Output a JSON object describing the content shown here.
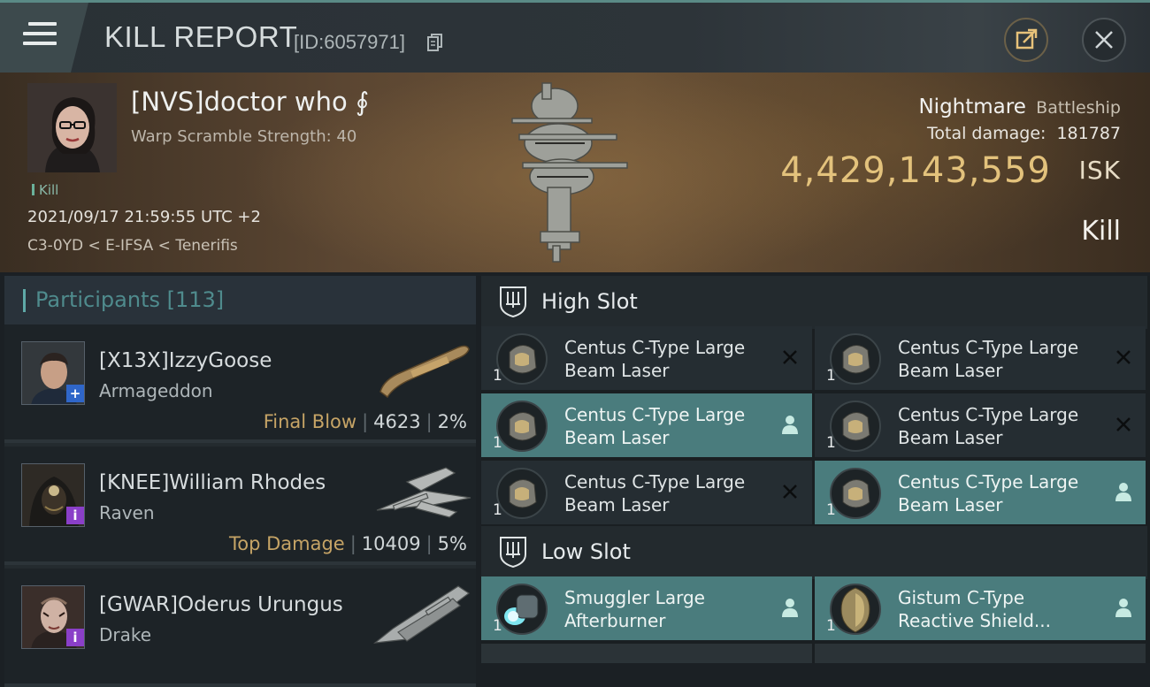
{
  "header": {
    "title": "KILL REPORT",
    "report_id": "[ID:6057971]"
  },
  "victim": {
    "name": "[NVS]doctor who ∮",
    "warp_scramble": "Warp Scramble Strength: 40",
    "kill_tag": "Kill",
    "timestamp": "2021/09/17 21:59:55 UTC +2",
    "location": "C3-0YD < E-IFSA < Tenerifis",
    "ship_name": "Nightmare",
    "ship_class": "Battleship",
    "total_damage_label": "Total damage:",
    "total_damage": "181787",
    "isk_value": "4,429,143,559",
    "isk_unit": "ISK",
    "result": "Kill"
  },
  "participants": {
    "title": "Participants [113]",
    "rows": [
      {
        "name": "[X13X]IzzyGoose",
        "ship": "Armageddon",
        "label": "Final Blow",
        "damage": "4623",
        "percent": "2%",
        "badge": "+",
        "badge_color": "#2f66c9"
      },
      {
        "name": "[KNEE]William Rhodes",
        "ship": "Raven",
        "label": "Top Damage",
        "damage": "10409",
        "percent": "5%",
        "badge": "i",
        "badge_color": "#8a3fc8"
      },
      {
        "name": "[GWAR]Oderus Urungus",
        "ship": "Drake",
        "label": "",
        "damage": "",
        "percent": "",
        "badge": "i",
        "badge_color": "#8a3fc8"
      }
    ]
  },
  "fitting": {
    "high_slot_title": "High Slot",
    "low_slot_title": "Low Slot",
    "high_modules": [
      {
        "line1": "Centus C-Type Large",
        "line2": "Beam Laser",
        "qty": "1",
        "state": "destroyed"
      },
      {
        "line1": "Centus C-Type Large",
        "line2": "Beam Laser",
        "qty": "1",
        "state": "destroyed"
      },
      {
        "line1": "Centus C-Type Large",
        "line2": "Beam Laser",
        "qty": "1",
        "state": "dropped"
      },
      {
        "line1": "Centus C-Type Large",
        "line2": "Beam Laser",
        "qty": "1",
        "state": "destroyed"
      },
      {
        "line1": "Centus C-Type Large",
        "line2": "Beam Laser",
        "qty": "1",
        "state": "destroyed"
      },
      {
        "line1": "Centus C-Type Large",
        "line2": "Beam Laser",
        "qty": "1",
        "state": "dropped"
      }
    ],
    "low_modules": [
      {
        "line1": "Smuggler Large",
        "line2": "Afterburner",
        "qty": "1",
        "state": "dropped"
      },
      {
        "line1": "Gistum C-Type",
        "line2": "Reactive Shield...",
        "qty": "1",
        "state": "dropped"
      }
    ]
  },
  "colors": {
    "accent_teal": "#4a7c7d",
    "isk_gold": "#e3c27c",
    "stat_label_gold": "#c6a466"
  }
}
